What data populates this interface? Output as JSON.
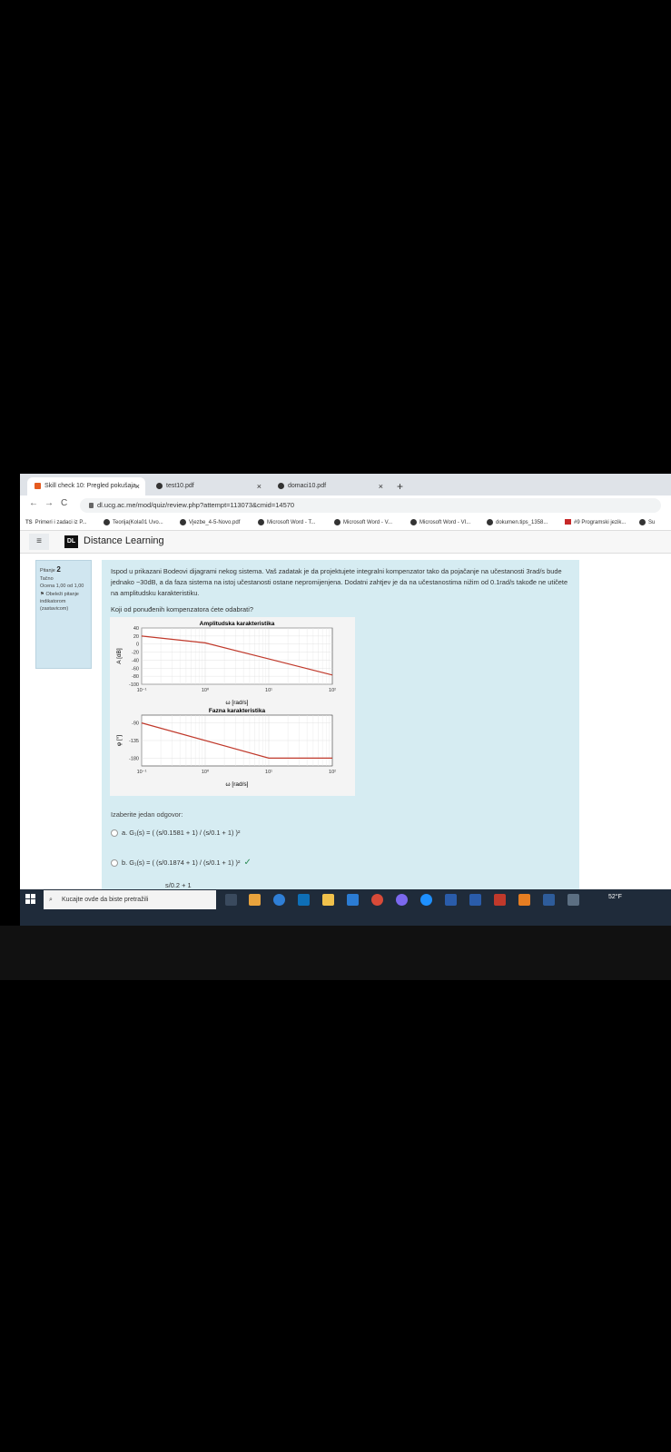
{
  "browser": {
    "tabs": [
      {
        "label": "Skill check 10: Pregled pokušaja",
        "active": true
      },
      {
        "label": "test10.pdf",
        "active": false
      },
      {
        "label": "domaci10.pdf",
        "active": false
      }
    ],
    "tab_close": "×",
    "new_tab": "+",
    "url": "dl.ucg.ac.me/mod/quiz/review.php?attempt=113073&cmid=14570",
    "back": "←",
    "forward": "→",
    "reload": "C",
    "bookmarks": [
      {
        "label": "Primeri i zadaci iz P...",
        "icon": "ts"
      },
      {
        "label": "Teorija(Kola01 Uvo...",
        "icon": "dot"
      },
      {
        "label": "Vjezbe_4-5-Novo.pdf",
        "icon": "dot"
      },
      {
        "label": "Microsoft Word - T...",
        "icon": "dot"
      },
      {
        "label": "Microsoft Word - V...",
        "icon": "dot"
      },
      {
        "label": "Microsoft Word - VI...",
        "icon": "dot"
      },
      {
        "label": "dokumen.tips_1358...",
        "icon": "dot"
      },
      {
        "label": "#9 Programski jezik...",
        "icon": "sq"
      },
      {
        "label": "Su",
        "icon": "dot"
      }
    ]
  },
  "site": {
    "menu_icon": "≡",
    "logo_text": "DL",
    "name": "Distance Learning"
  },
  "question_info": {
    "label": "Pitanje",
    "number": "2",
    "status": "Tačno",
    "grade": "Ocena 1,00 od 1,00",
    "flag": "Obeleži pitanje indikatorom (zastavicom)"
  },
  "question": {
    "text": "Ispod u prikazani Bodeovi dijagrami nekog sistema. Vaš zadatak je da projektujete integralni kompenzator tako da pojačanje na učestanosti 3rad/s bude jednako −30dB, a da faza sistema na istoj učestanosti ostane nepromijenjena. Dodatni zahtjev je da na učestanostima nižim od 0.1rad/s takođe ne utičete na amplitudsku karakteristiku.",
    "ask": "Koji od ponuđenih kompenzatora ćete odabrati?",
    "answer_prompt": "Izaberite jedan odgovor:",
    "options": [
      {
        "label": "a. G₁(s) = ( (s/0.1581 + 1) / (s/0.1 + 1) )²",
        "correct": false
      },
      {
        "label": "b. G₁(s) = ( (s/0.1874 + 1) / (s/0.1 + 1) )²",
        "correct": true
      },
      {
        "label": "s/0.2 + 1",
        "correct": false
      }
    ],
    "check_mark": "✓"
  },
  "chart_data": [
    {
      "type": "line",
      "title": "Amplitudska karakteristika",
      "ylabel": "A [dB]",
      "xlabel": "ω [rad/s]",
      "xscale": "log",
      "xlim": [
        0.1,
        100
      ],
      "ylim": [
        -100,
        40
      ],
      "yticks": [
        "40",
        "20",
        "0",
        "-20",
        "-40",
        "-60",
        "-80",
        "-100"
      ],
      "xticks": [
        "10⁻¹",
        "10⁰",
        "10¹",
        "10²"
      ],
      "grid": true,
      "color": "#c0392b",
      "x": [
        0.1,
        1,
        10,
        100
      ],
      "y": [
        20,
        3,
        -37,
        -77
      ]
    },
    {
      "type": "line",
      "title": "Fazna karakteristika",
      "ylabel": "φ [°]",
      "xlabel": "ω [rad/s]",
      "xscale": "log",
      "xlim": [
        0.1,
        100
      ],
      "ylim": [
        -200,
        -70
      ],
      "yticks": [
        "-90",
        "-135",
        "-180"
      ],
      "xticks": [
        "10⁻¹",
        "10⁰",
        "10¹",
        "10²"
      ],
      "grid": true,
      "color": "#c0392b",
      "x": [
        0.1,
        10,
        100
      ],
      "y": [
        -90,
        -180,
        -180
      ]
    }
  ],
  "taskbar": {
    "search_placeholder": "Kucajte ovde da biste pretražili",
    "temperature": "52°F",
    "colors": {
      "bar": "#1f2b3a"
    }
  }
}
